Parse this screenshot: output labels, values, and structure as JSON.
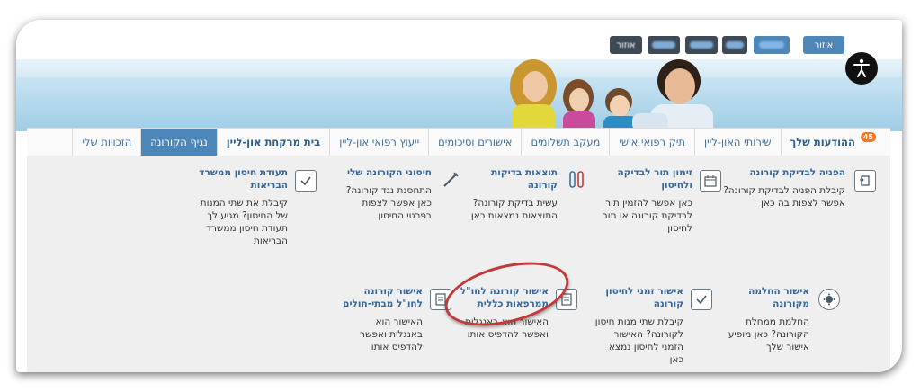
{
  "topbar": {
    "buttons": [
      {
        "label": "איזור",
        "style": "blue"
      },
      {
        "label": "",
        "style": "blue"
      },
      {
        "label": "",
        "style": "dark"
      },
      {
        "label": "",
        "style": "dark"
      },
      {
        "label": "",
        "style": "dark"
      },
      {
        "label": "אוזור",
        "style": "dark"
      }
    ]
  },
  "accessibility_icon": "accessibility-icon",
  "tabs": [
    {
      "label": "ההודעות שלך",
      "badge": "45"
    },
    {
      "label": "שירותי האון-ליין"
    },
    {
      "label": "תיק רפואי אישי"
    },
    {
      "label": "מעקב תשלומים"
    },
    {
      "label": "אישורים וסיכומים"
    },
    {
      "label": "ייעוץ רפואי און-ליין"
    },
    {
      "label": "בית מרקחת און-ליין"
    },
    {
      "label": "נגיף הקורונה",
      "active": true
    },
    {
      "label": "הזכויות שלי"
    }
  ],
  "cards": [
    {
      "title": "הפניה לבדיקת קורונה",
      "desc": "קיבלת הפניה לבדיקת קורונה? אפשר לצפות בה כאן",
      "icon": "referral-icon"
    },
    {
      "title": "זימון תור לבדיקה ולחיסון",
      "desc": "כאן אפשר להזמין תור לבדיקת קורונה או תור לחיסון",
      "icon": "calendar-icon"
    },
    {
      "title": "תוצאות בדיקות קורונה",
      "desc": "עשית בדיקת קורונה? התוצאות נמצאות כאן",
      "icon": "test-tubes-icon"
    },
    {
      "title": "חיסוני הקורונה שלי",
      "desc": "התחסנת נגד קורונה? כאן אפשר לצפות בפרטי החיסון",
      "icon": "syringe-icon"
    },
    {
      "title": "תעודת חיסון ממשרד הבריאות",
      "desc": "קיבלת את שתי המנות של החיסון? מגיע לך תעודת חיסון ממשרד הבריאות",
      "icon": "certificate-icon"
    },
    {
      "title": "אישור החלמה מקורונה",
      "desc": "החלמת ממחלת הקורונה? כאן מופיע אישור שלך",
      "icon": "virus-icon"
    },
    {
      "title": "אישור זמני לחיסון קורונה",
      "desc": "קיבלת שתי מנות חיסון לקורונה? האישור הזמני לחיסון נמצא כאן",
      "icon": "checklist-icon"
    },
    {
      "title": "אישור קורונה לחו\"ל ממרפאות כללית",
      "desc": "האישור הוא באנגלית ואפשר להדפיס אותו",
      "icon": "document-icon"
    },
    {
      "title": "אישור קורונה לחו\"ל מבתי-חולים",
      "desc": "האישור הוא באנגלית ואפשר להדפיס אותו",
      "icon": "document-icon"
    }
  ],
  "colors": {
    "accent": "#4d87b9",
    "link": "#35679a",
    "badge": "#f07828",
    "highlight": "#c13a3a"
  }
}
